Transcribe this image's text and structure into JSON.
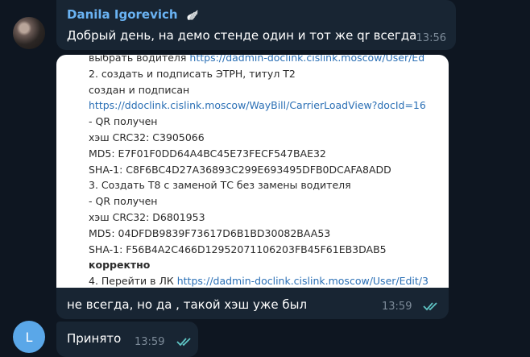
{
  "messages": [
    {
      "sender": "Danila Igorevich",
      "sender_badge": "🪽",
      "text": "Добрый день, на демо стенде один и тот же qr всегда",
      "time": "13:56"
    },
    {
      "attachment_lines": [
        {
          "text": "выбрать водителя ",
          "link": "https://dadmin-doclink.cislink.moscow/User/Ed"
        },
        {
          "text": "2. создать и подписать ЭТРН, титул Т2"
        },
        {
          "text": "создан и подписан"
        },
        {
          "text": "",
          "link": "https://ddoclink.cislink.moscow/WayBill/CarrierLoadView?docId=16"
        },
        {
          "text": "- QR получен"
        },
        {
          "text": "хэш CRC32: C3905066"
        },
        {
          "text": "MD5: E7F01F0DD64A4BC45E73FECF547BAE32"
        },
        {
          "text": "SHA-1: C8F6BC4D27A36893C299E693495DFB0DCAFA8ADD"
        },
        {
          "text": "3. Создать Т8 с заменой ТС без замены водителя"
        },
        {
          "text": "- QR получен"
        },
        {
          "text": "хэш CRC32: D6801953"
        },
        {
          "text": "MD5: 04DFDB9839F73617D6B1BD30082BAA53"
        },
        {
          "text": "SHA-1: F56B4A2C466D12952071106203FB45F61EB3DAB5"
        },
        {
          "text": "корректно",
          "bold": true
        },
        {
          "text": "4. Перейти в ЛК ",
          "link": "https://dadmin-doclink.cislink.moscow/User/Edit/3"
        }
      ],
      "text": "не всегда, но да , такой хэш уже был",
      "time": "13:59"
    },
    {
      "avatar_letter": "L",
      "text": "Принято",
      "time": "13:59"
    }
  ],
  "colors": {
    "background": "#0e1621",
    "bubble": "#182533",
    "sender": "#6ab3f3",
    "check": "#5fc4c4",
    "avatar_l": "#5aa7e8"
  },
  "icons": [
    "double-check-icon"
  ]
}
